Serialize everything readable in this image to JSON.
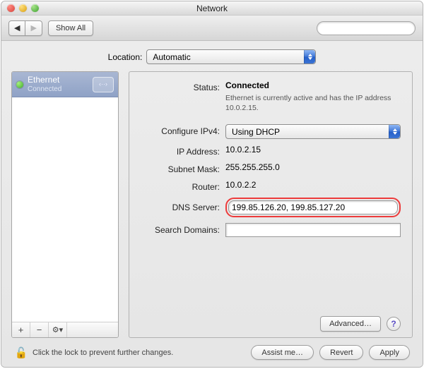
{
  "window": {
    "title": "Network"
  },
  "toolbar": {
    "back_label": "◀",
    "forward_label": "▶",
    "show_all_label": "Show All",
    "search_placeholder": ""
  },
  "location": {
    "label": "Location:",
    "selected": "Automatic"
  },
  "sidebar": {
    "services": [
      {
        "name": "Ethernet",
        "status": "Connected"
      }
    ],
    "add_label": "+",
    "remove_label": "−",
    "action_label": "⚙▾"
  },
  "detail": {
    "status_label": "Status:",
    "status_value": "Connected",
    "status_description": "Ethernet is currently active and has the IP address 10.0.2.15.",
    "configure_label": "Configure IPv4:",
    "configure_value": "Using DHCP",
    "ip_label": "IP Address:",
    "ip_value": "10.0.2.15",
    "subnet_label": "Subnet Mask:",
    "subnet_value": "255.255.255.0",
    "router_label": "Router:",
    "router_value": "10.0.2.2",
    "dns_label": "DNS Server:",
    "dns_value": "199.85.126.20, 199.85.127.20",
    "search_label": "Search Domains:",
    "search_value": "",
    "advanced_label": "Advanced…",
    "help_label": "?"
  },
  "footer": {
    "lock_text": "Click the lock to prevent further changes.",
    "assist_label": "Assist me…",
    "revert_label": "Revert",
    "apply_label": "Apply"
  }
}
